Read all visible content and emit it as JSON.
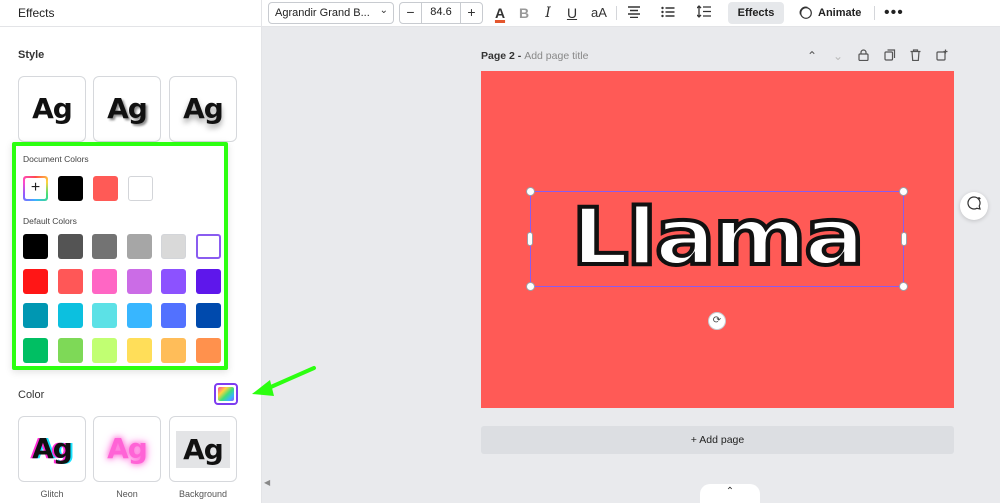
{
  "panel": {
    "title": "Effects",
    "style_label": "Style",
    "color_label": "Color",
    "style_cards_top": [
      "Ag",
      "Ag",
      "Ag"
    ],
    "style_cards_bottom": [
      {
        "glyph": "Ag",
        "label": "Glitch"
      },
      {
        "glyph": "Ag",
        "label": "Neon"
      },
      {
        "glyph": "Ag",
        "label": "Background"
      }
    ]
  },
  "toolbar": {
    "font": "Agrandir Grand B...",
    "size": "84.6",
    "minus": "−",
    "plus": "+",
    "effects": "Effects",
    "animate": "Animate",
    "more": "•••",
    "bold": "B",
    "italic": "I",
    "underline": "U",
    "case": "aA",
    "text_color_letter": "A"
  },
  "popover": {
    "document_title": "Document Colors",
    "default_title": "Default Colors",
    "add_symbol": "+",
    "document_colors": [
      "#000000",
      "#ff5a56",
      "#ffffff"
    ],
    "default_colors": [
      [
        "#000000",
        "#545454",
        "#737373",
        "#a6a6a6",
        "#d9d9d9",
        "#ffffff"
      ],
      [
        "#ff1616",
        "#ff5757",
        "#ff66c4",
        "#cb6ce6",
        "#8c52ff",
        "#5e17eb"
      ],
      [
        "#0097b2",
        "#0cc0df",
        "#5ce1e6",
        "#38b6ff",
        "#5271ff",
        "#004aad"
      ],
      [
        "#00bf63",
        "#7ed957",
        "#c1ff72",
        "#ffde59",
        "#ffbd59",
        "#ff914d"
      ]
    ]
  },
  "canvas": {
    "page_label": "Page 2",
    "page_title_placeholder": "Add page title",
    "page_color": "#ff5a56",
    "text": "Llama",
    "add_page": "+ Add page"
  }
}
